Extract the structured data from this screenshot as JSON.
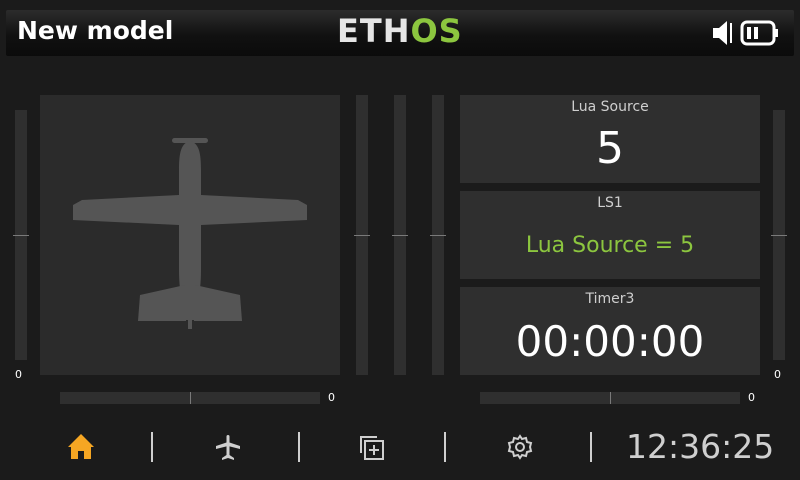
{
  "header": {
    "model_name": "New model",
    "logo_part1": "ETH",
    "logo_part2": "OS",
    "speaker_icon": "speaker-icon",
    "battery_icon": "battery-icon"
  },
  "trims": {
    "left_vertical_value": "0",
    "left_horizontal_value": "0",
    "right_horizontal_value": "0",
    "right_vertical_value": "0"
  },
  "model_image": {
    "icon": "airplane-silhouette"
  },
  "widgets": [
    {
      "title": "Lua Source",
      "value": "5"
    },
    {
      "title": "LS1",
      "value": "Lua Source = 5"
    },
    {
      "title": "Timer3",
      "value": "00:00:00"
    }
  ],
  "nav": {
    "items": [
      "home-icon",
      "airplane-icon",
      "displays-icon",
      "settings-icon"
    ],
    "active": "home-icon",
    "clock": "12:36:25"
  },
  "colors": {
    "accent_green": "#8cc63f",
    "active_orange": "#f5a623",
    "panel": "#2f2f2f",
    "background": "#1b1b1b"
  }
}
